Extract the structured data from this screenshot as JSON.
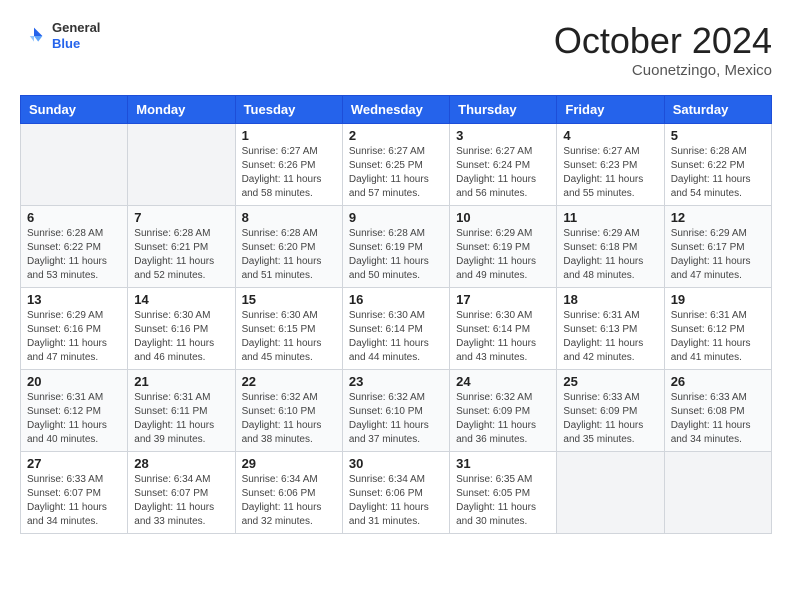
{
  "header": {
    "logo": {
      "general": "General",
      "blue": "Blue"
    },
    "month": "October 2024",
    "location": "Cuonetzingo, Mexico"
  },
  "weekdays": [
    "Sunday",
    "Monday",
    "Tuesday",
    "Wednesday",
    "Thursday",
    "Friday",
    "Saturday"
  ],
  "weeks": [
    [
      {
        "day": null
      },
      {
        "day": null
      },
      {
        "day": 1,
        "sunrise": "Sunrise: 6:27 AM",
        "sunset": "Sunset: 6:26 PM",
        "daylight": "Daylight: 11 hours and 58 minutes."
      },
      {
        "day": 2,
        "sunrise": "Sunrise: 6:27 AM",
        "sunset": "Sunset: 6:25 PM",
        "daylight": "Daylight: 11 hours and 57 minutes."
      },
      {
        "day": 3,
        "sunrise": "Sunrise: 6:27 AM",
        "sunset": "Sunset: 6:24 PM",
        "daylight": "Daylight: 11 hours and 56 minutes."
      },
      {
        "day": 4,
        "sunrise": "Sunrise: 6:27 AM",
        "sunset": "Sunset: 6:23 PM",
        "daylight": "Daylight: 11 hours and 55 minutes."
      },
      {
        "day": 5,
        "sunrise": "Sunrise: 6:28 AM",
        "sunset": "Sunset: 6:22 PM",
        "daylight": "Daylight: 11 hours and 54 minutes."
      }
    ],
    [
      {
        "day": 6,
        "sunrise": "Sunrise: 6:28 AM",
        "sunset": "Sunset: 6:22 PM",
        "daylight": "Daylight: 11 hours and 53 minutes."
      },
      {
        "day": 7,
        "sunrise": "Sunrise: 6:28 AM",
        "sunset": "Sunset: 6:21 PM",
        "daylight": "Daylight: 11 hours and 52 minutes."
      },
      {
        "day": 8,
        "sunrise": "Sunrise: 6:28 AM",
        "sunset": "Sunset: 6:20 PM",
        "daylight": "Daylight: 11 hours and 51 minutes."
      },
      {
        "day": 9,
        "sunrise": "Sunrise: 6:28 AM",
        "sunset": "Sunset: 6:19 PM",
        "daylight": "Daylight: 11 hours and 50 minutes."
      },
      {
        "day": 10,
        "sunrise": "Sunrise: 6:29 AM",
        "sunset": "Sunset: 6:19 PM",
        "daylight": "Daylight: 11 hours and 49 minutes."
      },
      {
        "day": 11,
        "sunrise": "Sunrise: 6:29 AM",
        "sunset": "Sunset: 6:18 PM",
        "daylight": "Daylight: 11 hours and 48 minutes."
      },
      {
        "day": 12,
        "sunrise": "Sunrise: 6:29 AM",
        "sunset": "Sunset: 6:17 PM",
        "daylight": "Daylight: 11 hours and 47 minutes."
      }
    ],
    [
      {
        "day": 13,
        "sunrise": "Sunrise: 6:29 AM",
        "sunset": "Sunset: 6:16 PM",
        "daylight": "Daylight: 11 hours and 47 minutes."
      },
      {
        "day": 14,
        "sunrise": "Sunrise: 6:30 AM",
        "sunset": "Sunset: 6:16 PM",
        "daylight": "Daylight: 11 hours and 46 minutes."
      },
      {
        "day": 15,
        "sunrise": "Sunrise: 6:30 AM",
        "sunset": "Sunset: 6:15 PM",
        "daylight": "Daylight: 11 hours and 45 minutes."
      },
      {
        "day": 16,
        "sunrise": "Sunrise: 6:30 AM",
        "sunset": "Sunset: 6:14 PM",
        "daylight": "Daylight: 11 hours and 44 minutes."
      },
      {
        "day": 17,
        "sunrise": "Sunrise: 6:30 AM",
        "sunset": "Sunset: 6:14 PM",
        "daylight": "Daylight: 11 hours and 43 minutes."
      },
      {
        "day": 18,
        "sunrise": "Sunrise: 6:31 AM",
        "sunset": "Sunset: 6:13 PM",
        "daylight": "Daylight: 11 hours and 42 minutes."
      },
      {
        "day": 19,
        "sunrise": "Sunrise: 6:31 AM",
        "sunset": "Sunset: 6:12 PM",
        "daylight": "Daylight: 11 hours and 41 minutes."
      }
    ],
    [
      {
        "day": 20,
        "sunrise": "Sunrise: 6:31 AM",
        "sunset": "Sunset: 6:12 PM",
        "daylight": "Daylight: 11 hours and 40 minutes."
      },
      {
        "day": 21,
        "sunrise": "Sunrise: 6:31 AM",
        "sunset": "Sunset: 6:11 PM",
        "daylight": "Daylight: 11 hours and 39 minutes."
      },
      {
        "day": 22,
        "sunrise": "Sunrise: 6:32 AM",
        "sunset": "Sunset: 6:10 PM",
        "daylight": "Daylight: 11 hours and 38 minutes."
      },
      {
        "day": 23,
        "sunrise": "Sunrise: 6:32 AM",
        "sunset": "Sunset: 6:10 PM",
        "daylight": "Daylight: 11 hours and 37 minutes."
      },
      {
        "day": 24,
        "sunrise": "Sunrise: 6:32 AM",
        "sunset": "Sunset: 6:09 PM",
        "daylight": "Daylight: 11 hours and 36 minutes."
      },
      {
        "day": 25,
        "sunrise": "Sunrise: 6:33 AM",
        "sunset": "Sunset: 6:09 PM",
        "daylight": "Daylight: 11 hours and 35 minutes."
      },
      {
        "day": 26,
        "sunrise": "Sunrise: 6:33 AM",
        "sunset": "Sunset: 6:08 PM",
        "daylight": "Daylight: 11 hours and 34 minutes."
      }
    ],
    [
      {
        "day": 27,
        "sunrise": "Sunrise: 6:33 AM",
        "sunset": "Sunset: 6:07 PM",
        "daylight": "Daylight: 11 hours and 34 minutes."
      },
      {
        "day": 28,
        "sunrise": "Sunrise: 6:34 AM",
        "sunset": "Sunset: 6:07 PM",
        "daylight": "Daylight: 11 hours and 33 minutes."
      },
      {
        "day": 29,
        "sunrise": "Sunrise: 6:34 AM",
        "sunset": "Sunset: 6:06 PM",
        "daylight": "Daylight: 11 hours and 32 minutes."
      },
      {
        "day": 30,
        "sunrise": "Sunrise: 6:34 AM",
        "sunset": "Sunset: 6:06 PM",
        "daylight": "Daylight: 11 hours and 31 minutes."
      },
      {
        "day": 31,
        "sunrise": "Sunrise: 6:35 AM",
        "sunset": "Sunset: 6:05 PM",
        "daylight": "Daylight: 11 hours and 30 minutes."
      },
      {
        "day": null
      },
      {
        "day": null
      }
    ]
  ]
}
